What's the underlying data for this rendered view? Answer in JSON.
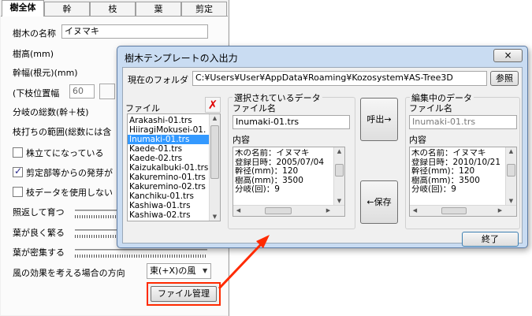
{
  "colors": {
    "highlight": "#ff2a00",
    "selection": "#3399ff",
    "dialog_frame": "#c9dcf2"
  },
  "main": {
    "tabs": [
      {
        "label": "樹全体",
        "active": true
      },
      {
        "label": "幹"
      },
      {
        "label": "枝"
      },
      {
        "label": "葉"
      },
      {
        "label": "剪定"
      }
    ],
    "tree_name_label": "樹木の名称",
    "tree_name_value": "イヌマキ",
    "height_label": "樹高(mm)",
    "trunk_label": "幹幅(根元)(mm)",
    "lower_branch_label": "(下枝位置幅",
    "lower_branch_value": "60",
    "branch_count_label": "分岐の総数(幹＋枝)",
    "topping_label": "枝打ちの範囲(総数には含",
    "checkbox_stand": {
      "label": "株立てになっている",
      "checked": false
    },
    "checkbox_prune": {
      "label": "剪定部等からの発芽が",
      "checked": true
    },
    "checkbox_branch": {
      "label": "枝データを使用しない",
      "checked": false
    },
    "slider_1_label": "照返して育つ",
    "slider_2_label": "葉が良く繁る",
    "slider_3_label": "葉が密集する",
    "wind_label": "風の効果を考える場合の方向",
    "wind_value": "東(+X)の風",
    "file_manage_label": "ファイル管理"
  },
  "dialog": {
    "title": "樹木テンプレートの入出力",
    "close_icon": "×",
    "folder_label": "現在のフォルダ",
    "folder_path": "C:¥Users¥User¥AppData¥Roaming¥Kozosystem¥AS-Tree3D",
    "browse_label": "参照",
    "file_list_label": "ファイル",
    "delete_icon": "✗",
    "files": [
      "Arakashi-01.trs",
      "HiiragiMokusei-01.",
      "Inumaki-01.trs",
      "Kaede-01.trs",
      "Kaede-02.trs",
      "KaizukaIbuki-01.trs",
      "Kakuremino-01.trs",
      "Kakuremino-02.trs",
      "Kanchiku-01.trs",
      "Kashiwa-01.trs",
      "Kashiwa-02.trs"
    ],
    "selected_index": 2,
    "selected_group_title": "選択されているデータ",
    "selected_file_label": "ファイル名",
    "selected_file_value": "Inumaki-01.trs",
    "selected_content_label": "内容",
    "selected_content_lines": [
      "木の名前：イヌマキ",
      "登録日時：2005/07/04",
      "幹径(mm)：120",
      "樹高(mm)：3500",
      "分岐(回)：9"
    ],
    "load_label": "呼出→",
    "save_label": "←保存",
    "editing_group_title": "編集中のデータ",
    "editing_file_label": "ファイル名",
    "editing_file_value": "Inumaki-01.trs",
    "editing_content_label": "内容",
    "editing_content_lines": [
      "木の名前：イヌマキ",
      "登録日時：2010/10/21",
      "幹径(mm)：120",
      "樹高(mm)：3500",
      "分岐(回)：9"
    ],
    "close_label": "終了"
  }
}
